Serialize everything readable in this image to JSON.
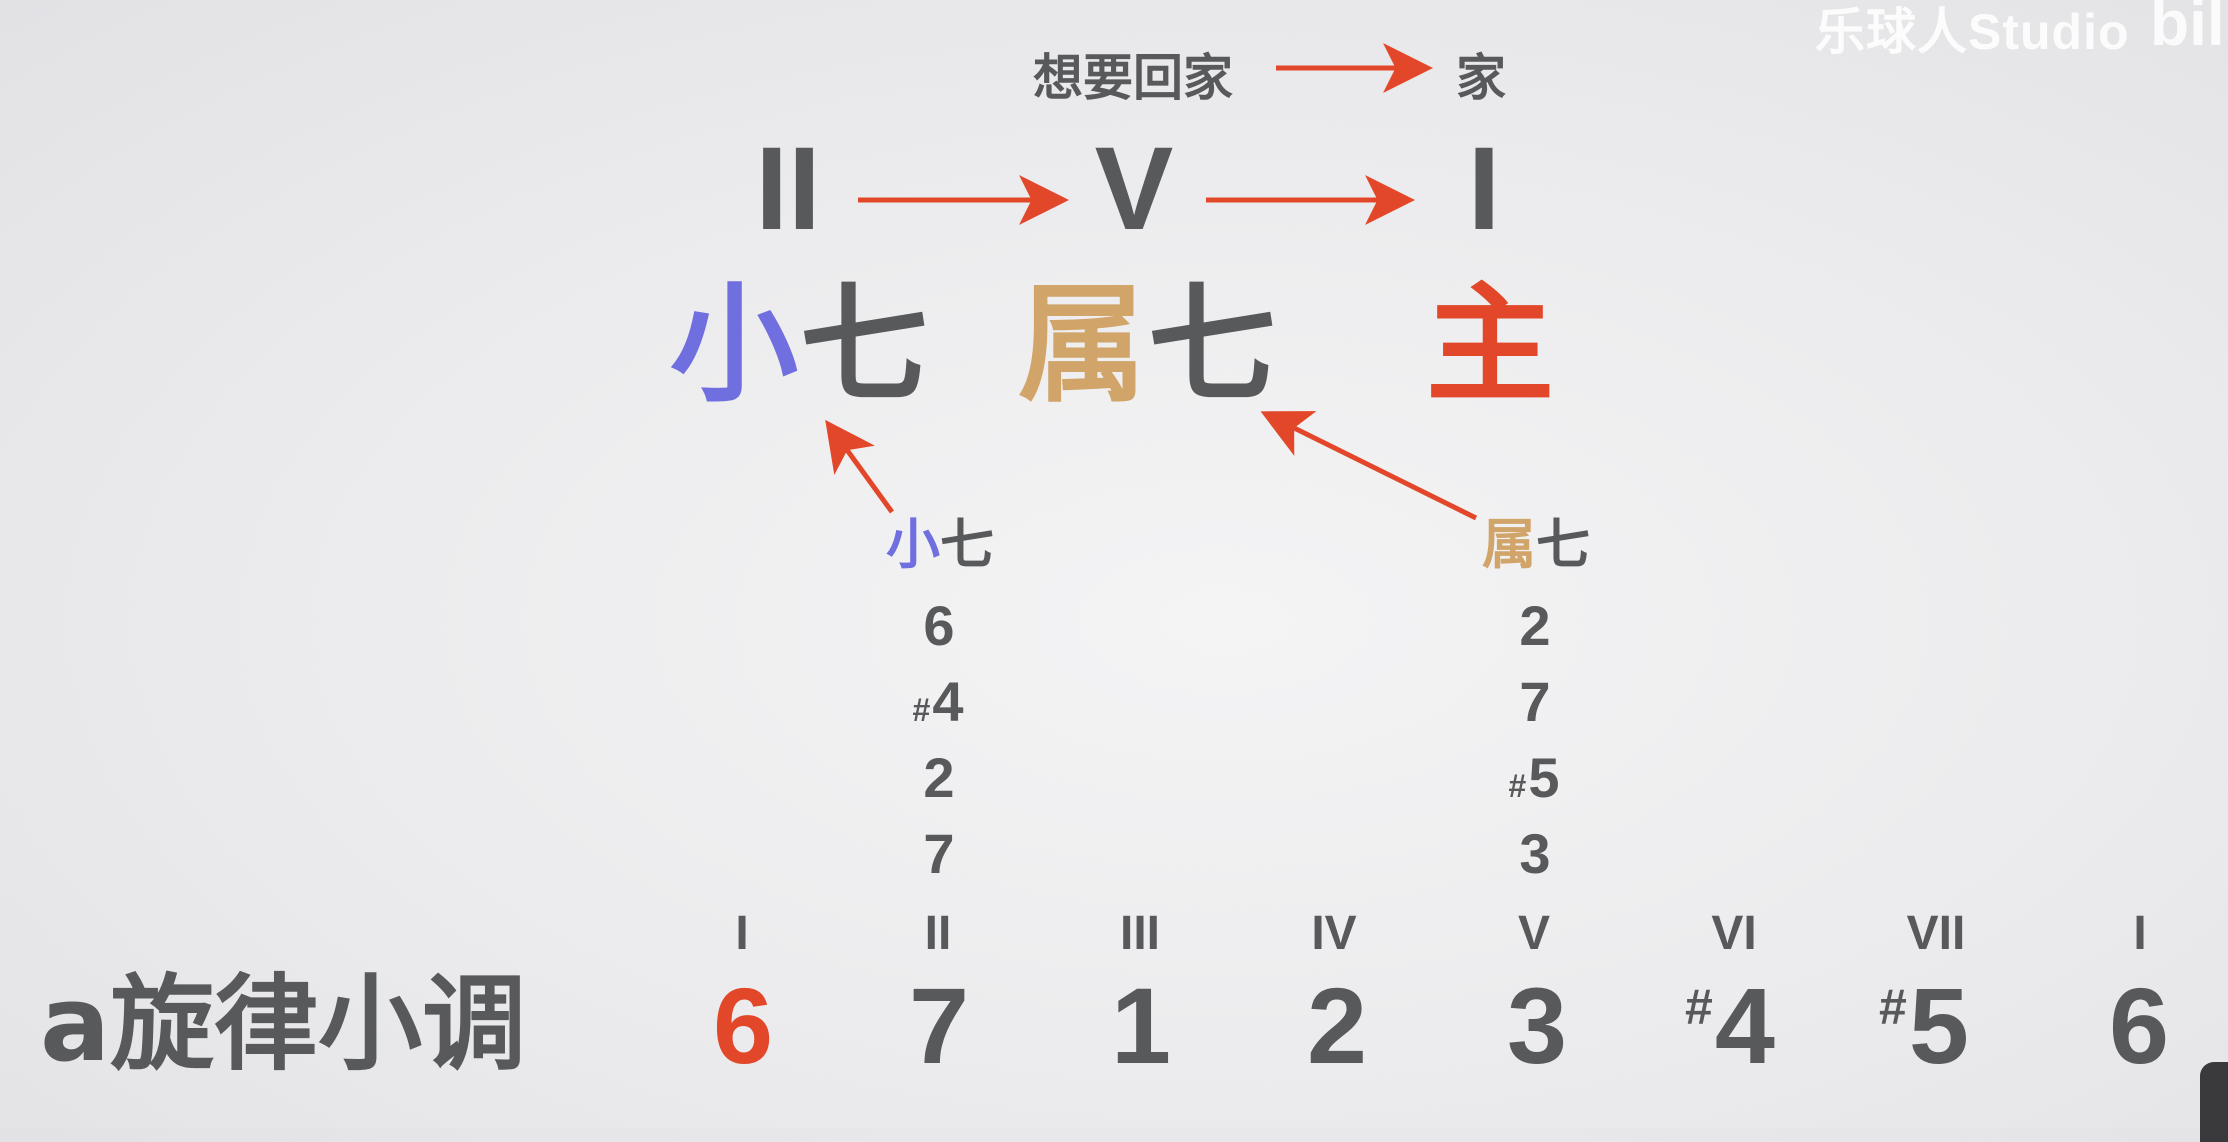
{
  "watermark": {
    "text": "乐球人Studio",
    "logo": "bili"
  },
  "colors": {
    "text": "#58595b",
    "arrow": "#e2472a",
    "minor": "#6f6fe0",
    "dominant": "#d1a46a",
    "tonic": "#e2472a"
  },
  "caption": {
    "left": "想要回家",
    "right": "家"
  },
  "progression": {
    "numerals": [
      "II",
      "V",
      "I"
    ],
    "chords": {
      "minor7": {
        "quality": "小",
        "seventh": "七"
      },
      "dom7": {
        "quality": "属",
        "seventh": "七"
      },
      "tonic": {
        "quality": "主"
      }
    }
  },
  "stacks": [
    {
      "label_quality": "小",
      "label_seventh": "七",
      "notes": [
        {
          "sharp": "",
          "num": "6"
        },
        {
          "sharp": "#",
          "num": "4"
        },
        {
          "sharp": "",
          "num": "2"
        },
        {
          "sharp": "",
          "num": "7"
        }
      ]
    },
    {
      "label_quality": "属",
      "label_seventh": "七",
      "notes": [
        {
          "sharp": "",
          "num": "2"
        },
        {
          "sharp": "",
          "num": "7"
        },
        {
          "sharp": "#",
          "num": "5"
        },
        {
          "sharp": "",
          "num": "3"
        }
      ]
    }
  ],
  "scale": {
    "title": "a旋律小调",
    "degrees": [
      "I",
      "II",
      "III",
      "IV",
      "V",
      "VI",
      "VII",
      "I"
    ],
    "notes": [
      {
        "sharp": "",
        "num": "6",
        "highlight": true
      },
      {
        "sharp": "",
        "num": "7"
      },
      {
        "sharp": "",
        "num": "1"
      },
      {
        "sharp": "",
        "num": "2"
      },
      {
        "sharp": "",
        "num": "3"
      },
      {
        "sharp": "#",
        "num": "4"
      },
      {
        "sharp": "#",
        "num": "5"
      },
      {
        "sharp": "",
        "num": "6"
      }
    ]
  }
}
